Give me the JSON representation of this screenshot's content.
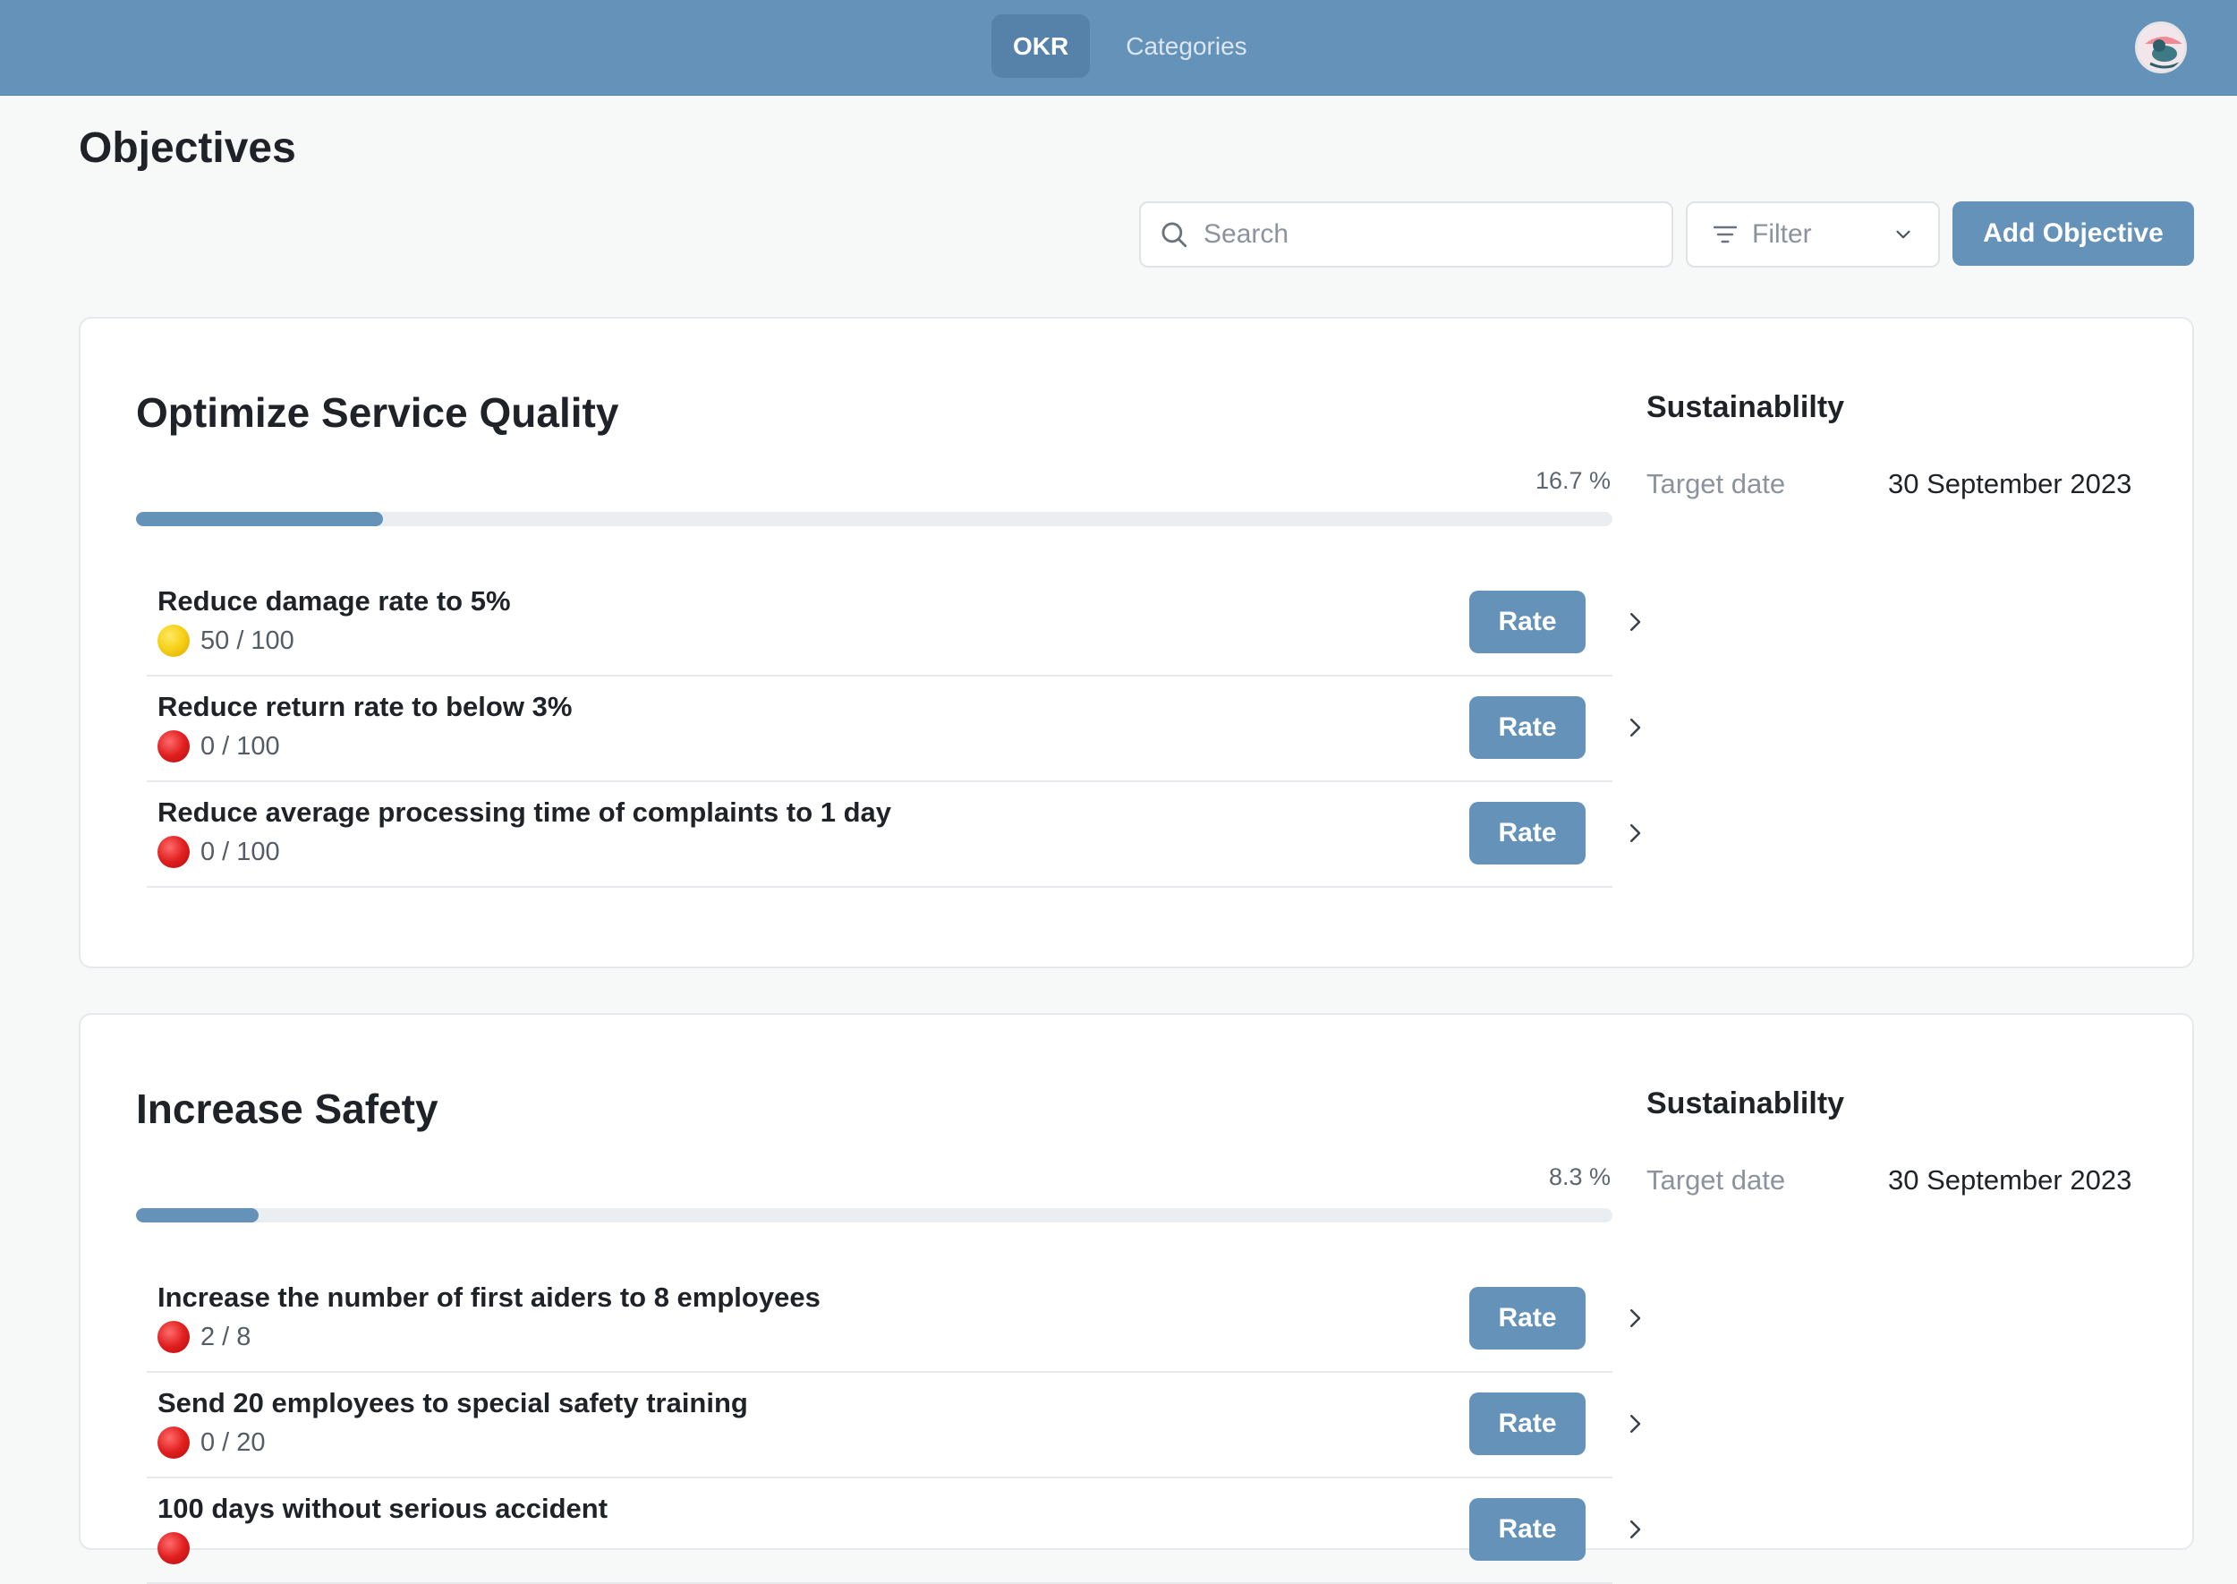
{
  "header": {
    "tabs": [
      {
        "label": "OKR",
        "active": true
      },
      {
        "label": "Categories",
        "active": false
      }
    ],
    "avatar_icon": "user-avatar-icon"
  },
  "page": {
    "title": "Objectives"
  },
  "toolbar": {
    "search_placeholder": "Search",
    "search_icon": "search-icon",
    "filter_label": "Filter",
    "filter_icon": "filter-icon",
    "add_label": "Add Objective"
  },
  "objectives": [
    {
      "title": "Optimize Service Quality",
      "progress_label": "16.7 %",
      "progress": 0.167,
      "category": "Sustainablilty",
      "target_date_label": "Target date",
      "target_date": "30 September 2023",
      "key_results": [
        {
          "title": "Reduce damage rate to 5%",
          "score": "50 / 100",
          "status": "yellow",
          "rate_label": "Rate"
        },
        {
          "title": "Reduce return rate to below 3%",
          "score": "0 / 100",
          "status": "red",
          "rate_label": "Rate"
        },
        {
          "title": "Reduce average processing time of complaints to 1 day",
          "score": "0 / 100",
          "status": "red",
          "rate_label": "Rate"
        }
      ]
    },
    {
      "title": "Increase Safety",
      "progress_label": "8.3 %",
      "progress": 0.083,
      "category": "Sustainablilty",
      "target_date_label": "Target date",
      "target_date": "30 September 2023",
      "key_results": [
        {
          "title": "Increase the number of first aiders to 8 employees",
          "score": "2 / 8",
          "status": "red",
          "rate_label": "Rate"
        },
        {
          "title": "Send 20 employees to special safety training",
          "score": "0 / 20",
          "status": "red",
          "rate_label": "Rate"
        },
        {
          "title": "100 days without serious accident",
          "score": "",
          "status": "red",
          "rate_label": "Rate"
        }
      ]
    }
  ],
  "colors": {
    "accent": "#6592b9",
    "status_yellow": "#f7d21a",
    "status_red": "#e0201f"
  }
}
